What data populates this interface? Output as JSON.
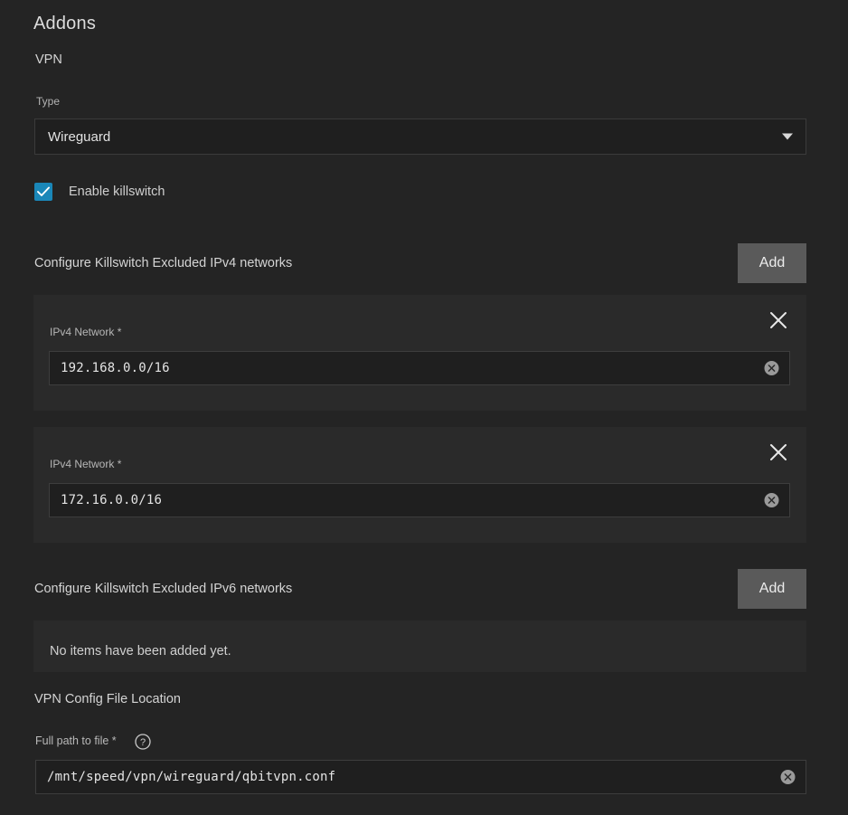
{
  "header": {
    "title": "Addons",
    "subtitle": "VPN"
  },
  "type_field": {
    "label": "Type",
    "value": "Wireguard",
    "caret_icon": "chevron-down-icon"
  },
  "killswitch": {
    "label": "Enable killswitch",
    "checked": true,
    "accent_color": "#1a87b8"
  },
  "ipv4_section": {
    "label": "Configure Killswitch Excluded IPv4 networks",
    "add_label": "Add",
    "items": [
      {
        "label": "IPv4 Network *",
        "value": "192.168.0.0/16",
        "remove_icon": "close-icon",
        "clear_icon": "clear-circle-icon"
      },
      {
        "label": "IPv4 Network *",
        "value": "172.16.0.0/16",
        "remove_icon": "close-icon",
        "clear_icon": "clear-circle-icon"
      }
    ]
  },
  "ipv6_section": {
    "label": "Configure Killswitch Excluded IPv6 networks",
    "add_label": "Add",
    "empty_message": "No items have been added yet.",
    "items": []
  },
  "vpn_config": {
    "title": "VPN Config File Location",
    "field_label": "Full path to file *",
    "help_icon": "help-circle-icon",
    "value": "/mnt/speed/vpn/wireguard/qbitvpn.conf",
    "clear_icon": "clear-circle-icon"
  },
  "colors": {
    "page_background": "#242424",
    "card_background": "#2a2a2a",
    "input_background": "#1f1f1f",
    "button_background": "#5a5a5a",
    "accent": "#1a87b8"
  }
}
